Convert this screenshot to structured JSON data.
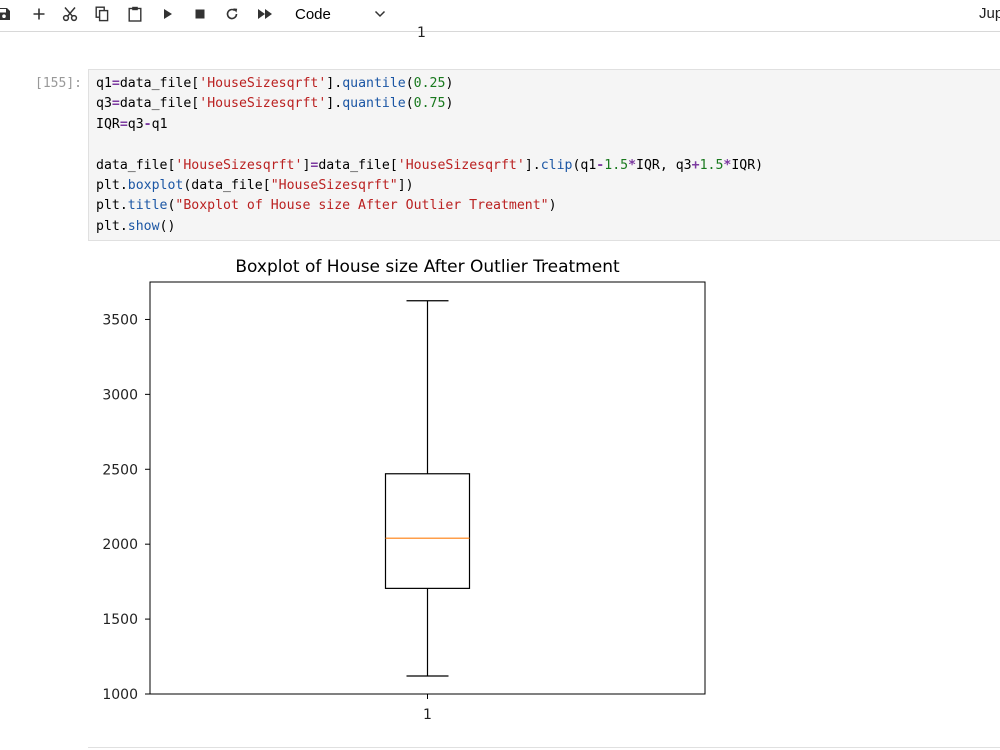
{
  "toolbar": {
    "buttons": [
      {
        "icon": "save-icon",
        "name": "save-button"
      },
      {
        "icon": "plus-icon",
        "name": "insert-cell-button"
      },
      {
        "icon": "scissors-icon",
        "name": "cut-button"
      },
      {
        "icon": "copy-icon",
        "name": "copy-button"
      },
      {
        "icon": "clipboard-icon",
        "name": "paste-button"
      },
      {
        "icon": "play-icon",
        "name": "run-button"
      },
      {
        "icon": "stop-icon",
        "name": "interrupt-button"
      },
      {
        "icon": "refresh-icon",
        "name": "restart-button"
      },
      {
        "icon": "fast-forward-icon",
        "name": "restart-run-all-button"
      }
    ],
    "cell_type": "Code",
    "brand": "Jup"
  },
  "previous_output": {
    "label": "1"
  },
  "cell": {
    "prompt": "[155]:",
    "code_lines": [
      "q1=data_file['HouseSizesqrft'].quantile(0.25)",
      "q3=data_file['HouseSizesqrft'].quantile(0.75)",
      "IQR=q3-q1",
      "",
      "data_file['HouseSizesqrft']=data_file['HouseSizesqrft'].clip(q1-1.5*IQR, q3+1.5*IQR)",
      "plt.boxplot(data_file[\"HouseSizesqrft\"])",
      "plt.title(\"Boxplot of House size After Outlier Treatment\")",
      "plt.show()"
    ]
  },
  "chart_data": {
    "type": "boxplot",
    "title": "Boxplot of House size After Outlier Treatment",
    "xlabel": "",
    "ylabel": "",
    "categories": [
      "1"
    ],
    "boxes": [
      {
        "label": "1",
        "whisker_low": 1120,
        "q1": 1705,
        "median": 2040,
        "q3": 2470,
        "whisker_high": 3625
      }
    ],
    "yticks": [
      1000,
      1500,
      2000,
      2500,
      3000,
      3500
    ],
    "ylim": [
      1000,
      3750
    ],
    "grid": false,
    "colors": {
      "box": "#000000",
      "median": "#ff7f0e"
    }
  }
}
